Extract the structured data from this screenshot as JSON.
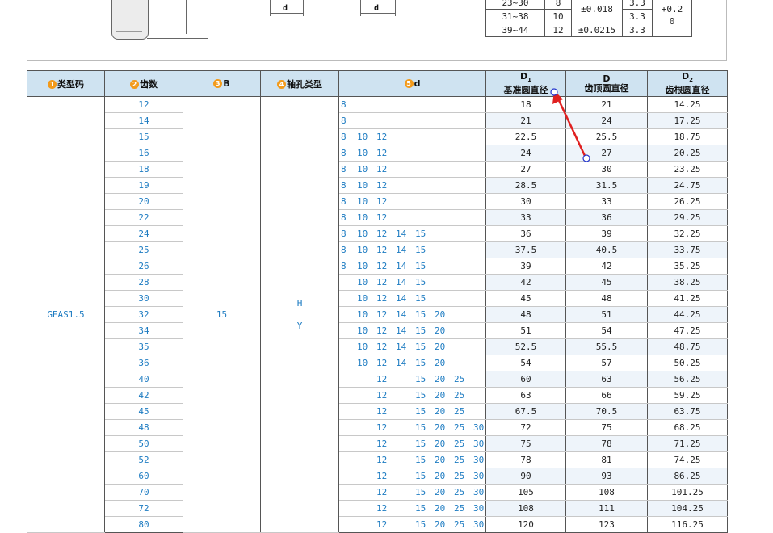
{
  "top": {
    "dim_label_1": "d",
    "dim_label_2": "d",
    "tolerance_rows": [
      [
        "23~30",
        "8",
        "±0.018",
        "3.3",
        "+0.2"
      ],
      [
        "31~38",
        "10",
        "",
        "3.3",
        "0"
      ],
      [
        "39~44",
        "12",
        "±0.0215",
        "3.3",
        ""
      ]
    ]
  },
  "headers": {
    "type_code": {
      "num": "1",
      "label": "类型码"
    },
    "teeth": {
      "num": "2",
      "label": "齿数"
    },
    "b": {
      "num": "3",
      "label": "B"
    },
    "bore_type": {
      "num": "4",
      "label": "轴孔类型"
    },
    "d": {
      "num": "5",
      "label": "d"
    },
    "d1": {
      "symbol": "D",
      "sub": "1",
      "label": "基准圆直径"
    },
    "dcol": {
      "symbol": "D",
      "label": "齿顶圆直径"
    },
    "d2": {
      "symbol": "D",
      "sub": "2",
      "label": "齿根圆直径"
    }
  },
  "type_code": "GEAS1.5",
  "b_value": "15",
  "bore_types": [
    "H",
    "Y"
  ],
  "d_options": [
    "8",
    "10",
    "12",
    "14",
    "15",
    "20",
    "25",
    "30"
  ],
  "rows": [
    {
      "teeth": "12",
      "d": [
        "8"
      ],
      "D1": "18",
      "D": "21",
      "D2": "14.25"
    },
    {
      "teeth": "14",
      "d": [
        "8"
      ],
      "D1": "21",
      "D": "24",
      "D2": "17.25"
    },
    {
      "teeth": "15",
      "d": [
        "8",
        "10",
        "12"
      ],
      "D1": "22.5",
      "D": "25.5",
      "D2": "18.75"
    },
    {
      "teeth": "16",
      "d": [
        "8",
        "10",
        "12"
      ],
      "D1": "24",
      "D": "27",
      "D2": "20.25"
    },
    {
      "teeth": "18",
      "d": [
        "8",
        "10",
        "12"
      ],
      "D1": "27",
      "D": "30",
      "D2": "23.25"
    },
    {
      "teeth": "19",
      "d": [
        "8",
        "10",
        "12"
      ],
      "D1": "28.5",
      "D": "31.5",
      "D2": "24.75"
    },
    {
      "teeth": "20",
      "d": [
        "8",
        "10",
        "12"
      ],
      "D1": "30",
      "D": "33",
      "D2": "26.25"
    },
    {
      "teeth": "22",
      "d": [
        "8",
        "10",
        "12"
      ],
      "D1": "33",
      "D": "36",
      "D2": "29.25"
    },
    {
      "teeth": "24",
      "d": [
        "8",
        "10",
        "12",
        "14",
        "15"
      ],
      "D1": "36",
      "D": "39",
      "D2": "32.25"
    },
    {
      "teeth": "25",
      "d": [
        "8",
        "10",
        "12",
        "14",
        "15"
      ],
      "D1": "37.5",
      "D": "40.5",
      "D2": "33.75"
    },
    {
      "teeth": "26",
      "d": [
        "8",
        "10",
        "12",
        "14",
        "15"
      ],
      "D1": "39",
      "D": "42",
      "D2": "35.25"
    },
    {
      "teeth": "28",
      "d": [
        "10",
        "12",
        "14",
        "15"
      ],
      "D1": "42",
      "D": "45",
      "D2": "38.25"
    },
    {
      "teeth": "30",
      "d": [
        "10",
        "12",
        "14",
        "15"
      ],
      "D1": "45",
      "D": "48",
      "D2": "41.25"
    },
    {
      "teeth": "32",
      "d": [
        "10",
        "12",
        "14",
        "15",
        "20"
      ],
      "D1": "48",
      "D": "51",
      "D2": "44.25"
    },
    {
      "teeth": "34",
      "d": [
        "10",
        "12",
        "14",
        "15",
        "20"
      ],
      "D1": "51",
      "D": "54",
      "D2": "47.25"
    },
    {
      "teeth": "35",
      "d": [
        "10",
        "12",
        "14",
        "15",
        "20"
      ],
      "D1": "52.5",
      "D": "55.5",
      "D2": "48.75"
    },
    {
      "teeth": "36",
      "d": [
        "10",
        "12",
        "14",
        "15",
        "20"
      ],
      "D1": "54",
      "D": "57",
      "D2": "50.25"
    },
    {
      "teeth": "40",
      "d": [
        "12",
        "15",
        "20",
        "25"
      ],
      "D1": "60",
      "D": "63",
      "D2": "56.25"
    },
    {
      "teeth": "42",
      "d": [
        "12",
        "15",
        "20",
        "25"
      ],
      "D1": "63",
      "D": "66",
      "D2": "59.25"
    },
    {
      "teeth": "45",
      "d": [
        "12",
        "15",
        "20",
        "25"
      ],
      "D1": "67.5",
      "D": "70.5",
      "D2": "63.75"
    },
    {
      "teeth": "48",
      "d": [
        "12",
        "15",
        "20",
        "25",
        "30"
      ],
      "D1": "72",
      "D": "75",
      "D2": "68.25"
    },
    {
      "teeth": "50",
      "d": [
        "12",
        "15",
        "20",
        "25",
        "30"
      ],
      "D1": "75",
      "D": "78",
      "D2": "71.25"
    },
    {
      "teeth": "52",
      "d": [
        "12",
        "15",
        "20",
        "25",
        "30"
      ],
      "D1": "78",
      "D": "81",
      "D2": "74.25"
    },
    {
      "teeth": "60",
      "d": [
        "12",
        "15",
        "20",
        "25",
        "30"
      ],
      "D1": "90",
      "D": "93",
      "D2": "86.25"
    },
    {
      "teeth": "70",
      "d": [
        "12",
        "15",
        "20",
        "25",
        "30"
      ],
      "D1": "105",
      "D": "108",
      "D2": "101.25"
    },
    {
      "teeth": "72",
      "d": [
        "12",
        "15",
        "20",
        "25",
        "30"
      ],
      "D1": "108",
      "D": "111",
      "D2": "104.25"
    },
    {
      "teeth": "80",
      "d": [
        "12",
        "15",
        "20",
        "25",
        "30"
      ],
      "D1": "120",
      "D": "123",
      "D2": "116.25"
    }
  ],
  "colors": {
    "header_bg": "#cfe3f1",
    "accent_blue": "#1e7cc2",
    "badge": "#f39a1a",
    "arrow": "#e02020"
  }
}
